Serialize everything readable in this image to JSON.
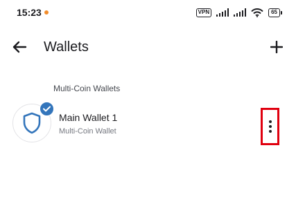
{
  "status_bar": {
    "time": "15:23",
    "vpn": "VPN",
    "battery": "65"
  },
  "app_bar": {
    "title": "Wallets",
    "back_icon": "arrow-left-icon",
    "add_icon": "plus-icon"
  },
  "section": {
    "header": "Multi-Coin Wallets"
  },
  "wallets": [
    {
      "name": "Main Wallet 1",
      "type": "Multi-Coin Wallet",
      "selected": true,
      "avatar_icon": "shield-icon",
      "menu_icon": "more-vertical-icon"
    }
  ],
  "colors": {
    "accent": "#3375bb",
    "highlight": "#e0000f"
  }
}
